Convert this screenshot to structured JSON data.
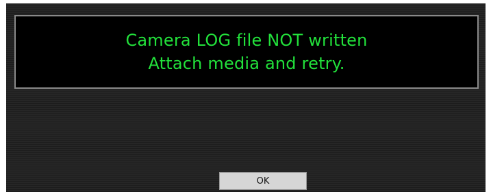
{
  "dialog": {
    "message": {
      "line1": "Camera LOG file NOT written",
      "line2": "Attach media and retry."
    },
    "ok_label": "OK"
  },
  "colors": {
    "message_text": "#22e13b",
    "panel_background": "#000000",
    "dialog_background": "#232323",
    "button_background": "#d6d6d6"
  }
}
